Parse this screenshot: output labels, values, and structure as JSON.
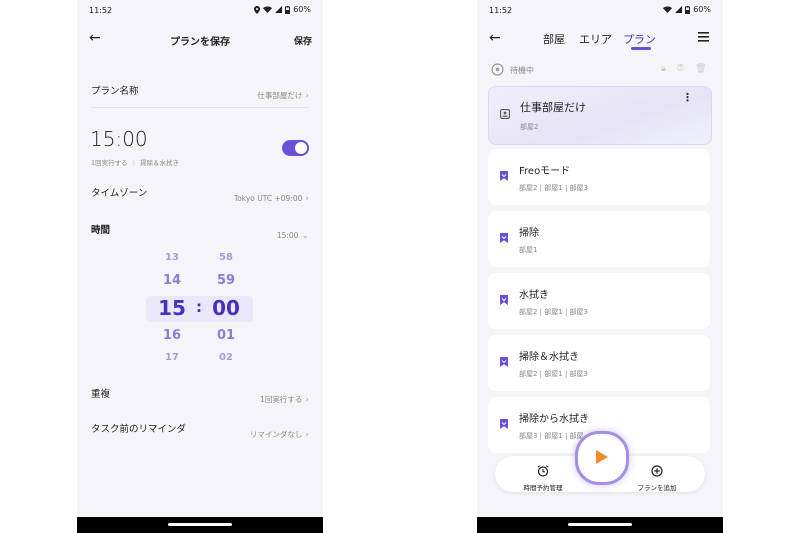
{
  "left": {
    "status": {
      "time": "11:52",
      "battery": "60%"
    },
    "header": {
      "title": "プランを保存",
      "save": "保存"
    },
    "plan_name": {
      "label": "プラン名称",
      "value": "仕事部屋だけ"
    },
    "schedule": {
      "time": "15:00",
      "repeat": "1回実行する",
      "mode": "掃除＆水拭き",
      "enabled": true
    },
    "timezone": {
      "label": "タイムゾーン",
      "value": "Tokyo UTC +09:00"
    },
    "time_row": {
      "label": "時間",
      "value": "15:00"
    },
    "picker": {
      "hours": [
        "13",
        "14",
        "15",
        "16",
        "17"
      ],
      "minutes": [
        "58",
        "59",
        "00",
        "01",
        "02"
      ],
      "separator": ":"
    },
    "repeat_row": {
      "label": "重複",
      "value": "1回実行する"
    },
    "reminder_row": {
      "label": "タスク前のリマインダ",
      "value": "リマインダなし"
    }
  },
  "right": {
    "status": {
      "time": "11:52",
      "battery": "60%"
    },
    "tabs": [
      "部屋",
      "エリア",
      "プラン"
    ],
    "active_tab": "プラン",
    "state": "待機中",
    "accent": "#6b4fd8",
    "plans": [
      {
        "title": "仕事部屋だけ",
        "rooms": "部屋2"
      },
      {
        "title": "Freoモード",
        "rooms": "部屋2 | 部屋1 | 部屋3"
      },
      {
        "title": "掃除",
        "rooms": "部屋1"
      },
      {
        "title": "水拭き",
        "rooms": "部屋2 | 部屋1 | 部屋3"
      },
      {
        "title": "掃除＆水拭き",
        "rooms": "部屋2 | 部屋1 | 部屋3"
      },
      {
        "title": "掃除から水拭き",
        "rooms": "部屋3 | 部屋1 | 部屋"
      }
    ],
    "bottom": {
      "schedule": "時間予約管理",
      "add": "プランを追加"
    }
  }
}
